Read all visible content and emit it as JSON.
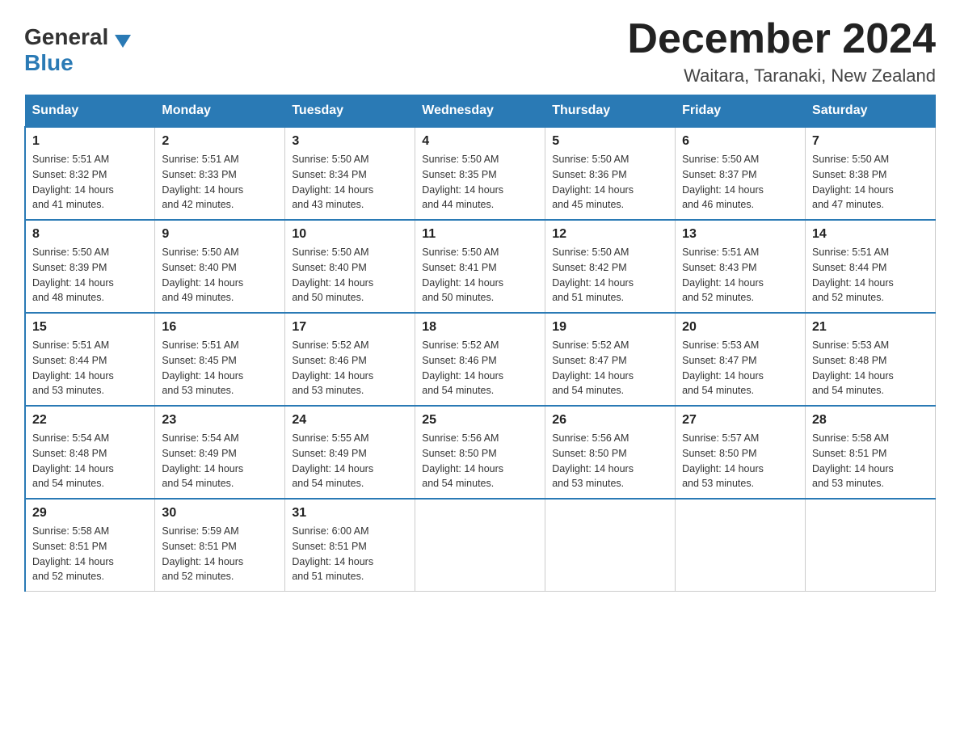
{
  "header": {
    "logo_general": "General",
    "logo_blue": "Blue",
    "month_title": "December 2024",
    "location": "Waitara, Taranaki, New Zealand"
  },
  "weekdays": [
    "Sunday",
    "Monday",
    "Tuesday",
    "Wednesday",
    "Thursday",
    "Friday",
    "Saturday"
  ],
  "weeks": [
    [
      {
        "day": "1",
        "sunrise": "5:51 AM",
        "sunset": "8:32 PM",
        "daylight": "14 hours and 41 minutes."
      },
      {
        "day": "2",
        "sunrise": "5:51 AM",
        "sunset": "8:33 PM",
        "daylight": "14 hours and 42 minutes."
      },
      {
        "day": "3",
        "sunrise": "5:50 AM",
        "sunset": "8:34 PM",
        "daylight": "14 hours and 43 minutes."
      },
      {
        "day": "4",
        "sunrise": "5:50 AM",
        "sunset": "8:35 PM",
        "daylight": "14 hours and 44 minutes."
      },
      {
        "day": "5",
        "sunrise": "5:50 AM",
        "sunset": "8:36 PM",
        "daylight": "14 hours and 45 minutes."
      },
      {
        "day": "6",
        "sunrise": "5:50 AM",
        "sunset": "8:37 PM",
        "daylight": "14 hours and 46 minutes."
      },
      {
        "day": "7",
        "sunrise": "5:50 AM",
        "sunset": "8:38 PM",
        "daylight": "14 hours and 47 minutes."
      }
    ],
    [
      {
        "day": "8",
        "sunrise": "5:50 AM",
        "sunset": "8:39 PM",
        "daylight": "14 hours and 48 minutes."
      },
      {
        "day": "9",
        "sunrise": "5:50 AM",
        "sunset": "8:40 PM",
        "daylight": "14 hours and 49 minutes."
      },
      {
        "day": "10",
        "sunrise": "5:50 AM",
        "sunset": "8:40 PM",
        "daylight": "14 hours and 50 minutes."
      },
      {
        "day": "11",
        "sunrise": "5:50 AM",
        "sunset": "8:41 PM",
        "daylight": "14 hours and 50 minutes."
      },
      {
        "day": "12",
        "sunrise": "5:50 AM",
        "sunset": "8:42 PM",
        "daylight": "14 hours and 51 minutes."
      },
      {
        "day": "13",
        "sunrise": "5:51 AM",
        "sunset": "8:43 PM",
        "daylight": "14 hours and 52 minutes."
      },
      {
        "day": "14",
        "sunrise": "5:51 AM",
        "sunset": "8:44 PM",
        "daylight": "14 hours and 52 minutes."
      }
    ],
    [
      {
        "day": "15",
        "sunrise": "5:51 AM",
        "sunset": "8:44 PM",
        "daylight": "14 hours and 53 minutes."
      },
      {
        "day": "16",
        "sunrise": "5:51 AM",
        "sunset": "8:45 PM",
        "daylight": "14 hours and 53 minutes."
      },
      {
        "day": "17",
        "sunrise": "5:52 AM",
        "sunset": "8:46 PM",
        "daylight": "14 hours and 53 minutes."
      },
      {
        "day": "18",
        "sunrise": "5:52 AM",
        "sunset": "8:46 PM",
        "daylight": "14 hours and 54 minutes."
      },
      {
        "day": "19",
        "sunrise": "5:52 AM",
        "sunset": "8:47 PM",
        "daylight": "14 hours and 54 minutes."
      },
      {
        "day": "20",
        "sunrise": "5:53 AM",
        "sunset": "8:47 PM",
        "daylight": "14 hours and 54 minutes."
      },
      {
        "day": "21",
        "sunrise": "5:53 AM",
        "sunset": "8:48 PM",
        "daylight": "14 hours and 54 minutes."
      }
    ],
    [
      {
        "day": "22",
        "sunrise": "5:54 AM",
        "sunset": "8:48 PM",
        "daylight": "14 hours and 54 minutes."
      },
      {
        "day": "23",
        "sunrise": "5:54 AM",
        "sunset": "8:49 PM",
        "daylight": "14 hours and 54 minutes."
      },
      {
        "day": "24",
        "sunrise": "5:55 AM",
        "sunset": "8:49 PM",
        "daylight": "14 hours and 54 minutes."
      },
      {
        "day": "25",
        "sunrise": "5:56 AM",
        "sunset": "8:50 PM",
        "daylight": "14 hours and 54 minutes."
      },
      {
        "day": "26",
        "sunrise": "5:56 AM",
        "sunset": "8:50 PM",
        "daylight": "14 hours and 53 minutes."
      },
      {
        "day": "27",
        "sunrise": "5:57 AM",
        "sunset": "8:50 PM",
        "daylight": "14 hours and 53 minutes."
      },
      {
        "day": "28",
        "sunrise": "5:58 AM",
        "sunset": "8:51 PM",
        "daylight": "14 hours and 53 minutes."
      }
    ],
    [
      {
        "day": "29",
        "sunrise": "5:58 AM",
        "sunset": "8:51 PM",
        "daylight": "14 hours and 52 minutes."
      },
      {
        "day": "30",
        "sunrise": "5:59 AM",
        "sunset": "8:51 PM",
        "daylight": "14 hours and 52 minutes."
      },
      {
        "day": "31",
        "sunrise": "6:00 AM",
        "sunset": "8:51 PM",
        "daylight": "14 hours and 51 minutes."
      },
      null,
      null,
      null,
      null
    ]
  ],
  "labels": {
    "sunrise": "Sunrise:",
    "sunset": "Sunset:",
    "daylight": "Daylight:"
  }
}
